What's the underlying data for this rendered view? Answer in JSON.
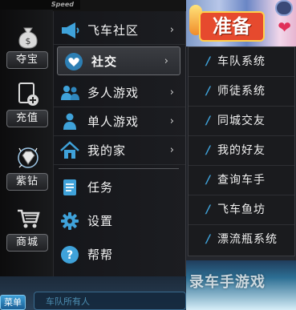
{
  "logo_text": "Speed",
  "features": [
    {
      "label": "夺宝",
      "icon": "money-bag-icon"
    },
    {
      "label": "充值",
      "icon": "recharge-icon"
    },
    {
      "label": "紫钻",
      "icon": "purple-diamond-icon"
    },
    {
      "label": "商城",
      "icon": "shopping-cart-icon"
    }
  ],
  "main_menu": {
    "items": [
      {
        "label": "飞车社区",
        "icon": "megaphone-icon",
        "arrow": "›"
      },
      {
        "label": "社交",
        "icon": "heart-icon",
        "arrow": "›"
      },
      {
        "label": "多人游戏",
        "icon": "multi-user-icon",
        "arrow": "›"
      },
      {
        "label": "单人游戏",
        "icon": "single-user-icon",
        "arrow": "›"
      },
      {
        "label": "我的家",
        "icon": "home-icon",
        "arrow": "›"
      },
      {
        "label": "任务",
        "icon": "task-list-icon",
        "arrow": ""
      },
      {
        "label": "设置",
        "icon": "gear-icon",
        "arrow": ""
      },
      {
        "label": "帮帮",
        "icon": "help-icon",
        "arrow": ""
      }
    ]
  },
  "sub_menu": {
    "items": [
      {
        "label": "车队系统"
      },
      {
        "label": "师徒系统"
      },
      {
        "label": "同城交友"
      },
      {
        "label": "我的好友"
      },
      {
        "label": "查询车手"
      },
      {
        "label": "飞车鱼坊"
      },
      {
        "label": "漂流瓶系统"
      }
    ]
  },
  "banner_text": "准备",
  "bottom": {
    "menu_button": "菜单",
    "chat_placeholder": "车队所有人"
  },
  "watermark": "录车手游戏",
  "colors": {
    "sub_accent": "#3fa2da",
    "menu_bg": "#1c1d21",
    "active_item": "#3b3d42"
  }
}
